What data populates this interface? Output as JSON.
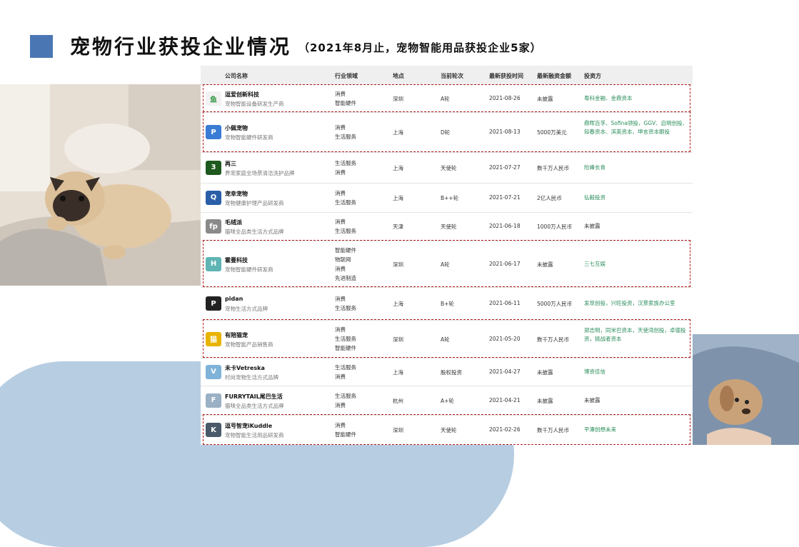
{
  "header": {
    "title": "宠物行业获投企业情况",
    "subtitle": "（2021年8月止，宠物智能用品获投企业5家）"
  },
  "table": {
    "columns": [
      "公司名称",
      "行业领域",
      "地点",
      "当前轮次",
      "最新获投时间",
      "最新融资金额",
      "投资方"
    ],
    "rows": [
      {
        "name": "逗爱创新科技",
        "desc": "宠物智能设备研发生产商",
        "industries": [
          "消费",
          "智能硬件"
        ],
        "location": "深圳",
        "round": "A轮",
        "date": "2021-08-26",
        "amount": "未披露",
        "investors": "粤科金融、金鼎资本",
        "logo": "鱼",
        "logo_color": "#f2f2f2",
        "highlight": true
      },
      {
        "name": "小佩宠物",
        "desc": "宠物智能硬件研发商",
        "industries": [
          "消费",
          "生活服务"
        ],
        "location": "上海",
        "round": "D轮",
        "date": "2021-08-13",
        "amount": "5000万美元",
        "investors": "鼎晖百孚、Sofina领投，GGV、启明创投、知春资本、滨英资本、坤言资本跟投",
        "logo": "P",
        "logo_color": "#3a7bd5",
        "highlight": true
      },
      {
        "name": "再三",
        "desc": "养宠家庭全场景清洁洗护品牌",
        "industries": [
          "生活服务",
          "消费"
        ],
        "location": "上海",
        "round": "天使轮",
        "date": "2021-07-27",
        "amount": "数千万人民币",
        "investors": "险峰长青",
        "logo": "3",
        "logo_color": "#1e5a1e",
        "highlight": false
      },
      {
        "name": "宠幸宠物",
        "desc": "宠物健康护理产品研发商",
        "industries": [
          "消费",
          "生活服务"
        ],
        "location": "上海",
        "round": "B++轮",
        "date": "2021-07-21",
        "amount": "2亿人民币",
        "investors": "弘毅投资",
        "logo": "Q",
        "logo_color": "#2a5fa8",
        "highlight": false
      },
      {
        "name": "毛绒派",
        "desc": "猫咪全品类生活方式品牌",
        "industries": [
          "消费",
          "生活服务"
        ],
        "location": "天津",
        "round": "天使轮",
        "date": "2021-06-18",
        "amount": "1000万人民币",
        "investors": "未披露",
        "investors_plain": true,
        "logo": "fp",
        "logo_color": "#8a8a8a",
        "highlight": false
      },
      {
        "name": "霍曼科技",
        "desc": "宠物智能硬件研发商",
        "industries": [
          "智能硬件",
          "物联网",
          "消费",
          "先进制造"
        ],
        "location": "深圳",
        "round": "A轮",
        "date": "2021-06-17",
        "amount": "未披露",
        "investors": "三七互娱",
        "logo": "H",
        "logo_color": "#5fb4b4",
        "highlight": true
      },
      {
        "name": "pidan",
        "desc": "宠物生活方式品牌",
        "industries": [
          "消费",
          "生活服务"
        ],
        "location": "上海",
        "round": "B+轮",
        "date": "2021-06-11",
        "amount": "5000万人民币",
        "investors": "发现创投，兴旺投资，汉景家族办公室",
        "logo": "P",
        "logo_color": "#222222",
        "highlight": false
      },
      {
        "name": "有陪猫宠",
        "desc": "宠物智能产品销售商",
        "industries": [
          "消费",
          "生活服务",
          "智能硬件"
        ],
        "location": "深圳",
        "round": "A轮",
        "date": "2021-05-20",
        "amount": "数千万人民币",
        "investors": "郑志明，同米巴资本，天使湾创投，卓德投资，挑战者资本",
        "logo": "猫",
        "logo_color": "#e8b400",
        "highlight": true
      },
      {
        "name": "未卡Vetreska",
        "desc": "时尚宠物生活方式品牌",
        "industries": [
          "生活服务",
          "消费"
        ],
        "location": "上海",
        "round": "股权投资",
        "date": "2021-04-27",
        "amount": "未披露",
        "investors": "博资佳信",
        "logo": "V",
        "logo_color": "#7fb3d8",
        "highlight": false
      },
      {
        "name": "FURRYTAIL尾巴生活",
        "desc": "猫咪全品类生活方式品牌",
        "industries": [
          "生活服务",
          "消费"
        ],
        "location": "杭州",
        "round": "A+轮",
        "date": "2021-04-21",
        "amount": "未披露",
        "investors": "未披露",
        "investors_plain": true,
        "logo": "F",
        "logo_color": "#9ab0c4",
        "highlight": false
      },
      {
        "name": "逗号智宠iKuddle",
        "desc": "宠物智能生活用品研发商",
        "industries": [
          "消费",
          "智能硬件"
        ],
        "location": "深圳",
        "round": "天使轮",
        "date": "2021-02-26",
        "amount": "数千万人民币",
        "investors": "平潭创想未来",
        "logo": "K",
        "logo_color": "#4a5a6a",
        "highlight": true
      }
    ]
  }
}
